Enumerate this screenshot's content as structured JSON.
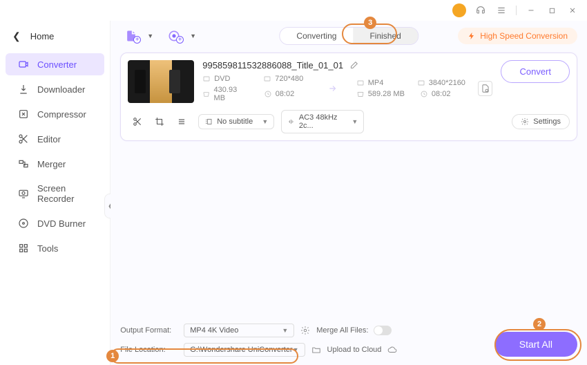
{
  "titlebar": {
    "avatar_letter": ""
  },
  "home_label": "Home",
  "sidebar": {
    "items": [
      {
        "label": "Converter"
      },
      {
        "label": "Downloader"
      },
      {
        "label": "Compressor"
      },
      {
        "label": "Editor"
      },
      {
        "label": "Merger"
      },
      {
        "label": "Screen Recorder"
      },
      {
        "label": "DVD Burner"
      },
      {
        "label": "Tools"
      }
    ]
  },
  "tabs": {
    "converting": "Converting",
    "finished": "Finished"
  },
  "high_speed": "High Speed Conversion",
  "item": {
    "title": "995859811532886088_Title_01_01",
    "src": {
      "format": "DVD",
      "resolution": "720*480",
      "size": "430.93 MB",
      "duration": "08:02"
    },
    "dst": {
      "format": "MP4",
      "resolution": "3840*2160",
      "size": "589.28 MB",
      "duration": "08:02"
    },
    "subtitle": "No subtitle",
    "audio": "AC3 48kHz 2c...",
    "settings_label": "Settings",
    "convert_label": "Convert"
  },
  "footer": {
    "output_format_label": "Output Format:",
    "output_format_value": "MP4 4K Video",
    "file_location_label": "File Location:",
    "file_location_value": "G:\\Wondershare UniConverter ",
    "merge_label": "Merge All Files:",
    "upload_label": "Upload to Cloud",
    "start_all": "Start All"
  },
  "badges": {
    "one": "1",
    "two": "2",
    "three": "3"
  }
}
